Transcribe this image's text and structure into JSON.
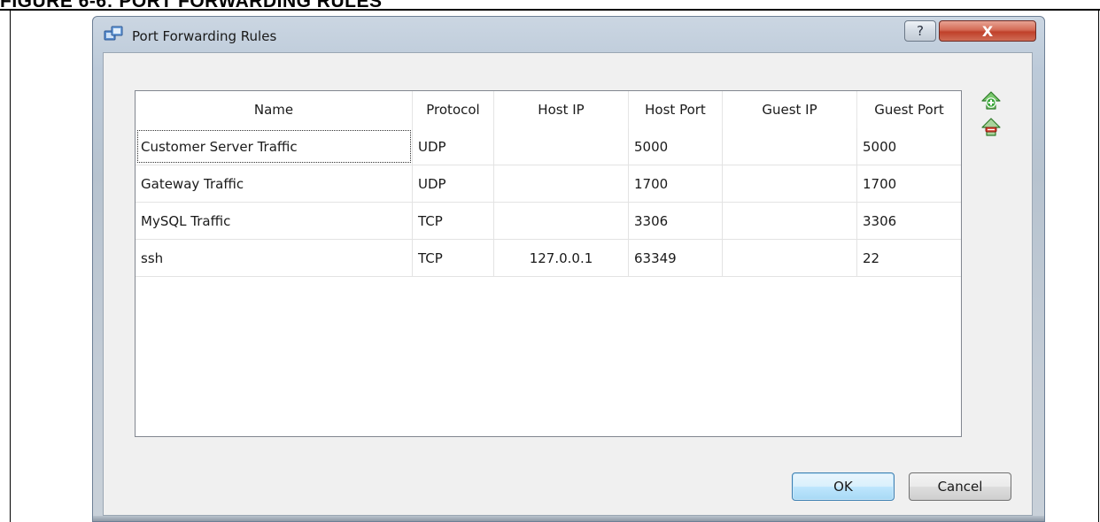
{
  "figure": {
    "title": "FIGURE 6-6:        PORT FORWARDING RULES"
  },
  "window": {
    "title": "Port Forwarding Rules",
    "help_label": "?",
    "close_label": "X"
  },
  "table": {
    "columns": [
      "Name",
      "Protocol",
      "Host IP",
      "Host Port",
      "Guest IP",
      "Guest Port"
    ],
    "rows": [
      {
        "name": "Customer Server Traffic",
        "protocol": "UDP",
        "host_ip": "",
        "host_port": "5000",
        "guest_ip": "",
        "guest_port": "5000"
      },
      {
        "name": "Gateway Traffic",
        "protocol": "UDP",
        "host_ip": "",
        "host_port": "1700",
        "guest_ip": "",
        "guest_port": "1700"
      },
      {
        "name": "MySQL Traffic",
        "protocol": "TCP",
        "host_ip": "",
        "host_port": "3306",
        "guest_ip": "",
        "guest_port": "3306"
      },
      {
        "name": "ssh",
        "protocol": "TCP",
        "host_ip": "127.0.0.1",
        "host_port": "63349",
        "guest_ip": "",
        "guest_port": "22"
      }
    ]
  },
  "side_tools": {
    "add_icon": "add-rule-icon",
    "remove_icon": "remove-rule-icon"
  },
  "buttons": {
    "ok": "OK",
    "cancel": "Cancel"
  },
  "colors": {
    "add_green": "#3aa63a",
    "remove_red": "#d23c2c",
    "ok_border": "#3c7fb1"
  }
}
